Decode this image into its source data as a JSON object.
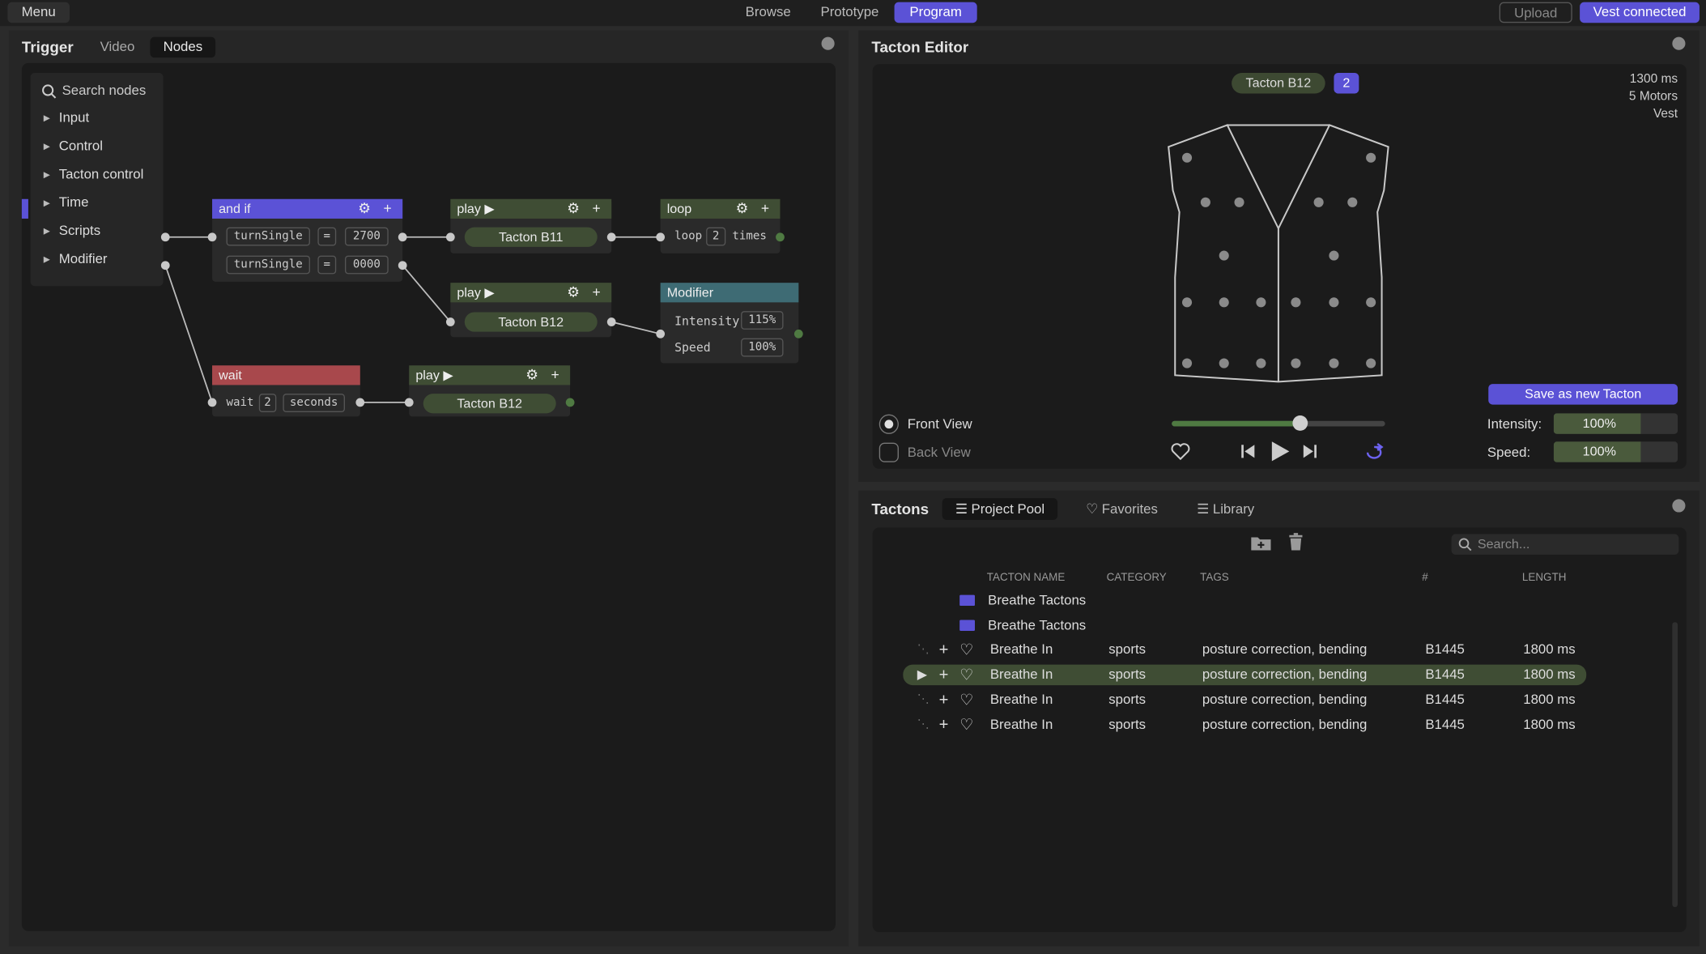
{
  "topbar": {
    "menu": "Menu",
    "tabs": [
      "Browse",
      "Prototype",
      "Program"
    ],
    "active_tab": "Program",
    "upload": "Upload",
    "vest": "Vest connected"
  },
  "trigger": {
    "title": "Trigger",
    "tabs": [
      "Video",
      "Nodes"
    ],
    "search": "Search nodes",
    "categories": [
      "Input",
      "Control",
      "Tacton control",
      "Time",
      "Scripts",
      "Modifier"
    ],
    "nodes": {
      "andif": {
        "title": "and if",
        "r1": {
          "a": "turnSingle",
          "op": "=",
          "b": "2700"
        },
        "r2": {
          "a": "turnSingle",
          "op": "=",
          "b": "0000"
        }
      },
      "play1": {
        "title": "play ▶",
        "tacton": "Tacton B11"
      },
      "play2": {
        "title": "play ▶",
        "tacton": "Tacton B12"
      },
      "play3": {
        "title": "play ▶",
        "tacton": "Tacton B12"
      },
      "loop": {
        "title": "loop",
        "label": "loop",
        "count": "2",
        "unit": "times"
      },
      "modifier": {
        "title": "Modifier",
        "intensity_label": "Intensity",
        "intensity": "115%",
        "speed_label": "Speed",
        "speed": "100%"
      },
      "wait": {
        "title": "wait",
        "label": "wait",
        "count": "2",
        "unit": "seconds"
      }
    }
  },
  "editor": {
    "title": "Tacton Editor",
    "tacton": "Tacton B12",
    "count": "2",
    "duration": "1300 ms",
    "motors": "5 Motors",
    "device": "Vest",
    "save": "Save as new Tacton",
    "front_view": "Front View",
    "back_view": "Back View",
    "intensity_label": "Intensity:",
    "intensity": "100%",
    "intensity_level": 0.7,
    "speed_label": "Speed:",
    "speed": "100%",
    "speed_level": 0.7,
    "playhead": 0.6
  },
  "tactons": {
    "title": "Tactons",
    "tabs": [
      "Project Pool",
      "Favorites",
      "Library"
    ],
    "search": "Search...",
    "columns": [
      "TACTON NAME",
      "CATEGORY",
      "TAGS",
      "#",
      "LENGTH"
    ],
    "folders": [
      "Breathe Tactons",
      "Breathe Tactons"
    ],
    "rows": [
      {
        "name": "Breathe In",
        "category": "sports",
        "tags": "posture correction, bending",
        "id": "B1445",
        "length": "1800 ms"
      },
      {
        "name": "Breathe In",
        "category": "sports",
        "tags": "posture correction, bending",
        "id": "B1445",
        "length": "1800 ms"
      },
      {
        "name": "Breathe In",
        "category": "sports",
        "tags": "posture correction, bending",
        "id": "B1445",
        "length": "1800 ms"
      },
      {
        "name": "Breathe In",
        "category": "sports",
        "tags": "posture correction, bending",
        "id": "B1445",
        "length": "1800 ms"
      }
    ],
    "selected_row": 1
  },
  "colors": {
    "accent": "#5b52d6",
    "andif": "#5b52d6",
    "wait": "#a8484c",
    "modifier": "#3e6b74",
    "play": "#3f4d34"
  }
}
